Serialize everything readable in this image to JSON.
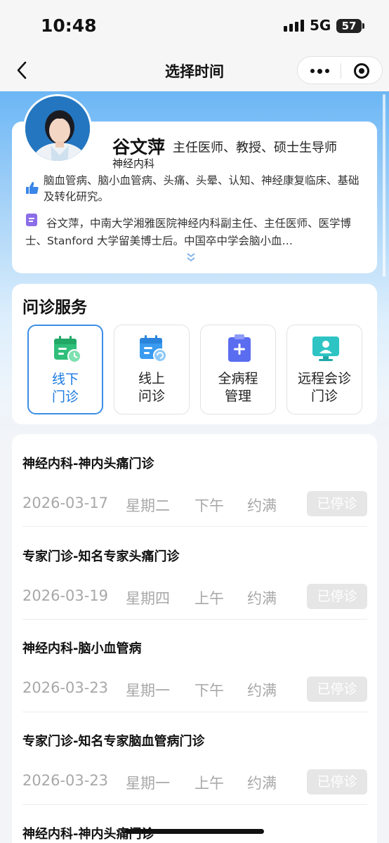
{
  "status_bar": {
    "time": "10:48",
    "network": "5G",
    "battery": "57"
  },
  "nav": {
    "title": "选择时间"
  },
  "doctor": {
    "name": "谷文萍",
    "title": "主任医师、教授、硕士生导师",
    "department": "神经内科",
    "expertise": "脑血管病、脑小血管病、头痛、头晕、认知、神经康复临床、基础及转化研究。",
    "intro": "谷文萍，中南大学湘雅医院神经内科副主任、主任医师、医学博士、Stanford 大学留美博士后。中国卒中学会脑小血…"
  },
  "services": {
    "title": "问诊服务",
    "items": [
      {
        "label": "线下\n门诊",
        "icon": "calendar-clock-icon",
        "active": true
      },
      {
        "label": "线上\n问诊",
        "icon": "calendar-refresh-icon",
        "active": false
      },
      {
        "label": "全病程\n管理",
        "icon": "clipboard-plus-icon",
        "active": false
      },
      {
        "label": "远程会诊\n门诊",
        "icon": "monitor-person-icon",
        "active": false
      }
    ]
  },
  "schedule": [
    {
      "clinic": "神经内科-神内头痛门诊",
      "date": "2026-03-17",
      "weekday": "星期二",
      "period": "下午",
      "status": "约满",
      "button": "已停诊"
    },
    {
      "clinic": "专家门诊-知名专家头痛门诊",
      "date": "2026-03-19",
      "weekday": "星期四",
      "period": "上午",
      "status": "约满",
      "button": "已停诊"
    },
    {
      "clinic": "神经内科-脑小血管病",
      "date": "2026-03-23",
      "weekday": "星期一",
      "period": "下午",
      "status": "约满",
      "button": "已停诊"
    },
    {
      "clinic": "专家门诊-知名专家脑血管病门诊",
      "date": "2026-03-23",
      "weekday": "星期一",
      "period": "上午",
      "status": "约满",
      "button": "已停诊"
    },
    {
      "clinic": "神经内科-神内头痛门诊"
    }
  ],
  "colors": {
    "accent": "#1a7ae0",
    "header_gradient": "#4aa0f0",
    "disabled_button": "#e6e6e6"
  }
}
